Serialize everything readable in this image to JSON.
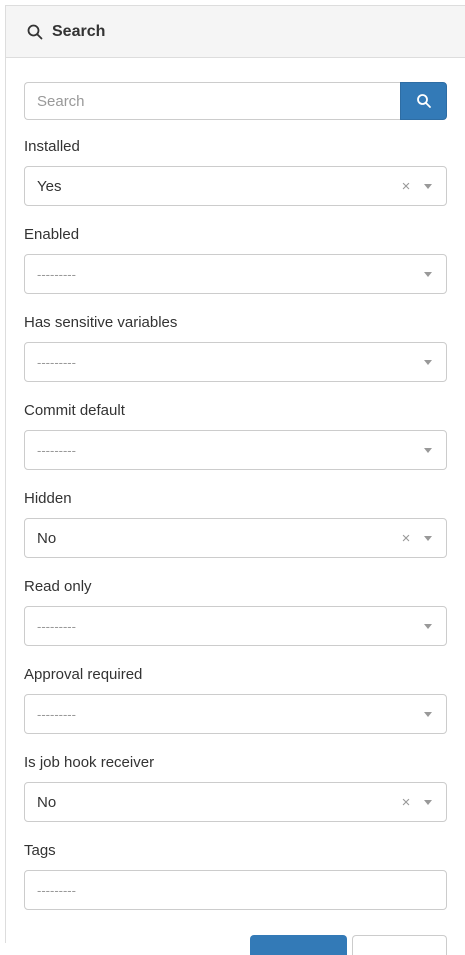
{
  "header": {
    "title": "Search",
    "icon": "search-icon"
  },
  "search": {
    "placeholder": "Search",
    "value": ""
  },
  "colors": {
    "primary": "#337ab7",
    "border": "#cccccc",
    "header_bg": "#f5f5f5"
  },
  "fields": [
    {
      "label": "Installed",
      "value": "Yes",
      "clearable": true
    },
    {
      "label": "Enabled",
      "value": "---------",
      "clearable": false
    },
    {
      "label": "Has sensitive variables",
      "value": "---------",
      "clearable": false
    },
    {
      "label": "Commit default",
      "value": "---------",
      "clearable": false
    },
    {
      "label": "Hidden",
      "value": "No",
      "clearable": true
    },
    {
      "label": "Read only",
      "value": "---------",
      "clearable": false
    },
    {
      "label": "Approval required",
      "value": "---------",
      "clearable": false
    },
    {
      "label": "Is job hook receiver",
      "value": "No",
      "clearable": true
    },
    {
      "label": "Tags",
      "value": "---------",
      "clearable": false
    }
  ],
  "clear_glyph": "×"
}
